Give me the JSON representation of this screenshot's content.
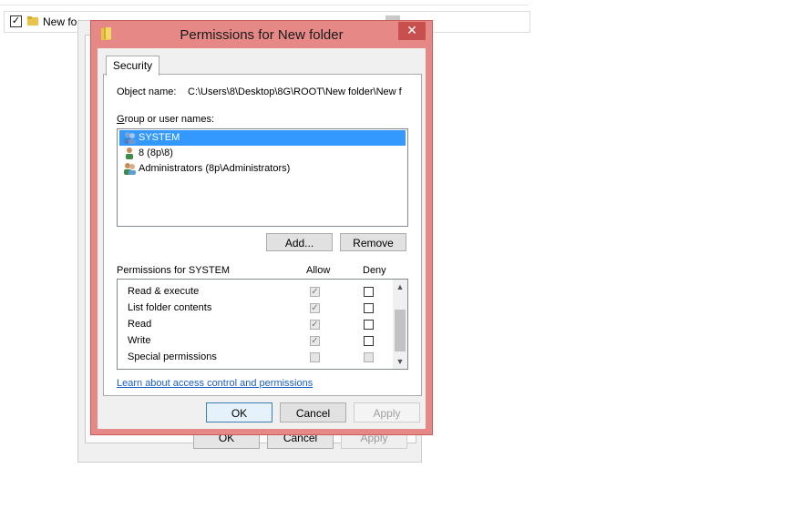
{
  "background": {
    "item_name": "New fo",
    "ok_label": "OK",
    "cancel_label": "Cancel",
    "apply_label": "Apply"
  },
  "dialog": {
    "title": "Permissions for New folder",
    "close_glyph": "✕",
    "tab_label": "Security",
    "object_name_label": "Object name:",
    "object_name_value": "C:\\Users\\8\\Desktop\\8G\\ROOT\\New folder\\New f",
    "group_label": "Group or user names:",
    "users": [
      {
        "name": "SYSTEM",
        "icon": "users-group-icon",
        "selected": true
      },
      {
        "name": "8 (8p\\8)",
        "icon": "user-icon",
        "selected": false
      },
      {
        "name": "Administrators (8p\\Administrators)",
        "icon": "users-group-icon",
        "selected": false
      }
    ],
    "add_label": "Add...",
    "remove_label": "Remove",
    "permissions_label": "Permissions for SYSTEM",
    "allow_header": "Allow",
    "deny_header": "Deny",
    "permissions": [
      {
        "name": "Read & execute",
        "allow": true,
        "deny": false
      },
      {
        "name": "List folder contents",
        "allow": true,
        "deny": false
      },
      {
        "name": "Read",
        "allow": true,
        "deny": false
      },
      {
        "name": "Write",
        "allow": true,
        "deny": false
      },
      {
        "name": "Special permissions",
        "allow": false,
        "deny": false
      }
    ],
    "learn_link": "Learn about access control and permissions",
    "ok_label": "OK",
    "cancel_label": "Cancel",
    "apply_label": "Apply"
  },
  "colors": {
    "title_active": "#e58886",
    "close_button": "#c7504f",
    "selection": "#3399ff",
    "link": "#1a5dc7"
  }
}
